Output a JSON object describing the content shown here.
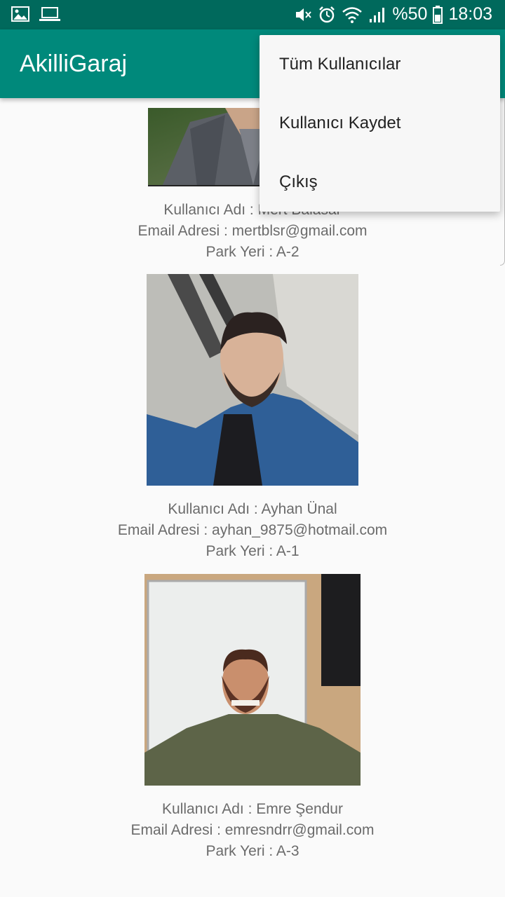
{
  "status_bar": {
    "icons_left": [
      "image-icon",
      "laptop-icon"
    ],
    "icons_right": [
      "mute-icon",
      "alarm-icon",
      "wifi-icon",
      "signal-icon",
      "battery-icon"
    ],
    "battery_percent": "%50",
    "time": "18:03"
  },
  "app_bar": {
    "title": "AkilliGaraj"
  },
  "menu": {
    "items": [
      {
        "label": "Tüm Kullanıcılar"
      },
      {
        "label": "Kullanıcı Kaydet"
      },
      {
        "label": "Çıkış"
      }
    ]
  },
  "users": [
    {
      "username_label": "Kullanıcı Adı : Mert Balasar",
      "email_label": "Email Adresi : mertblsr@gmail.com",
      "park_label": "Park Yeri : A-2"
    },
    {
      "username_label": "Kullanıcı Adı : Ayhan Ünal",
      "email_label": "Email Adresi : ayhan_9875@hotmail.com",
      "park_label": "Park Yeri : A-1"
    },
    {
      "username_label": "Kullanıcı Adı : Emre Şendur",
      "email_label": "Email Adresi : emresndrr@gmail.com",
      "park_label": "Park Yeri : A-3"
    }
  ],
  "colors": {
    "status_bar": "#00695c",
    "app_bar": "#00897b",
    "background": "#fafafa",
    "info_text": "#6b6b6b",
    "menu_bg": "#f7f7f7"
  }
}
